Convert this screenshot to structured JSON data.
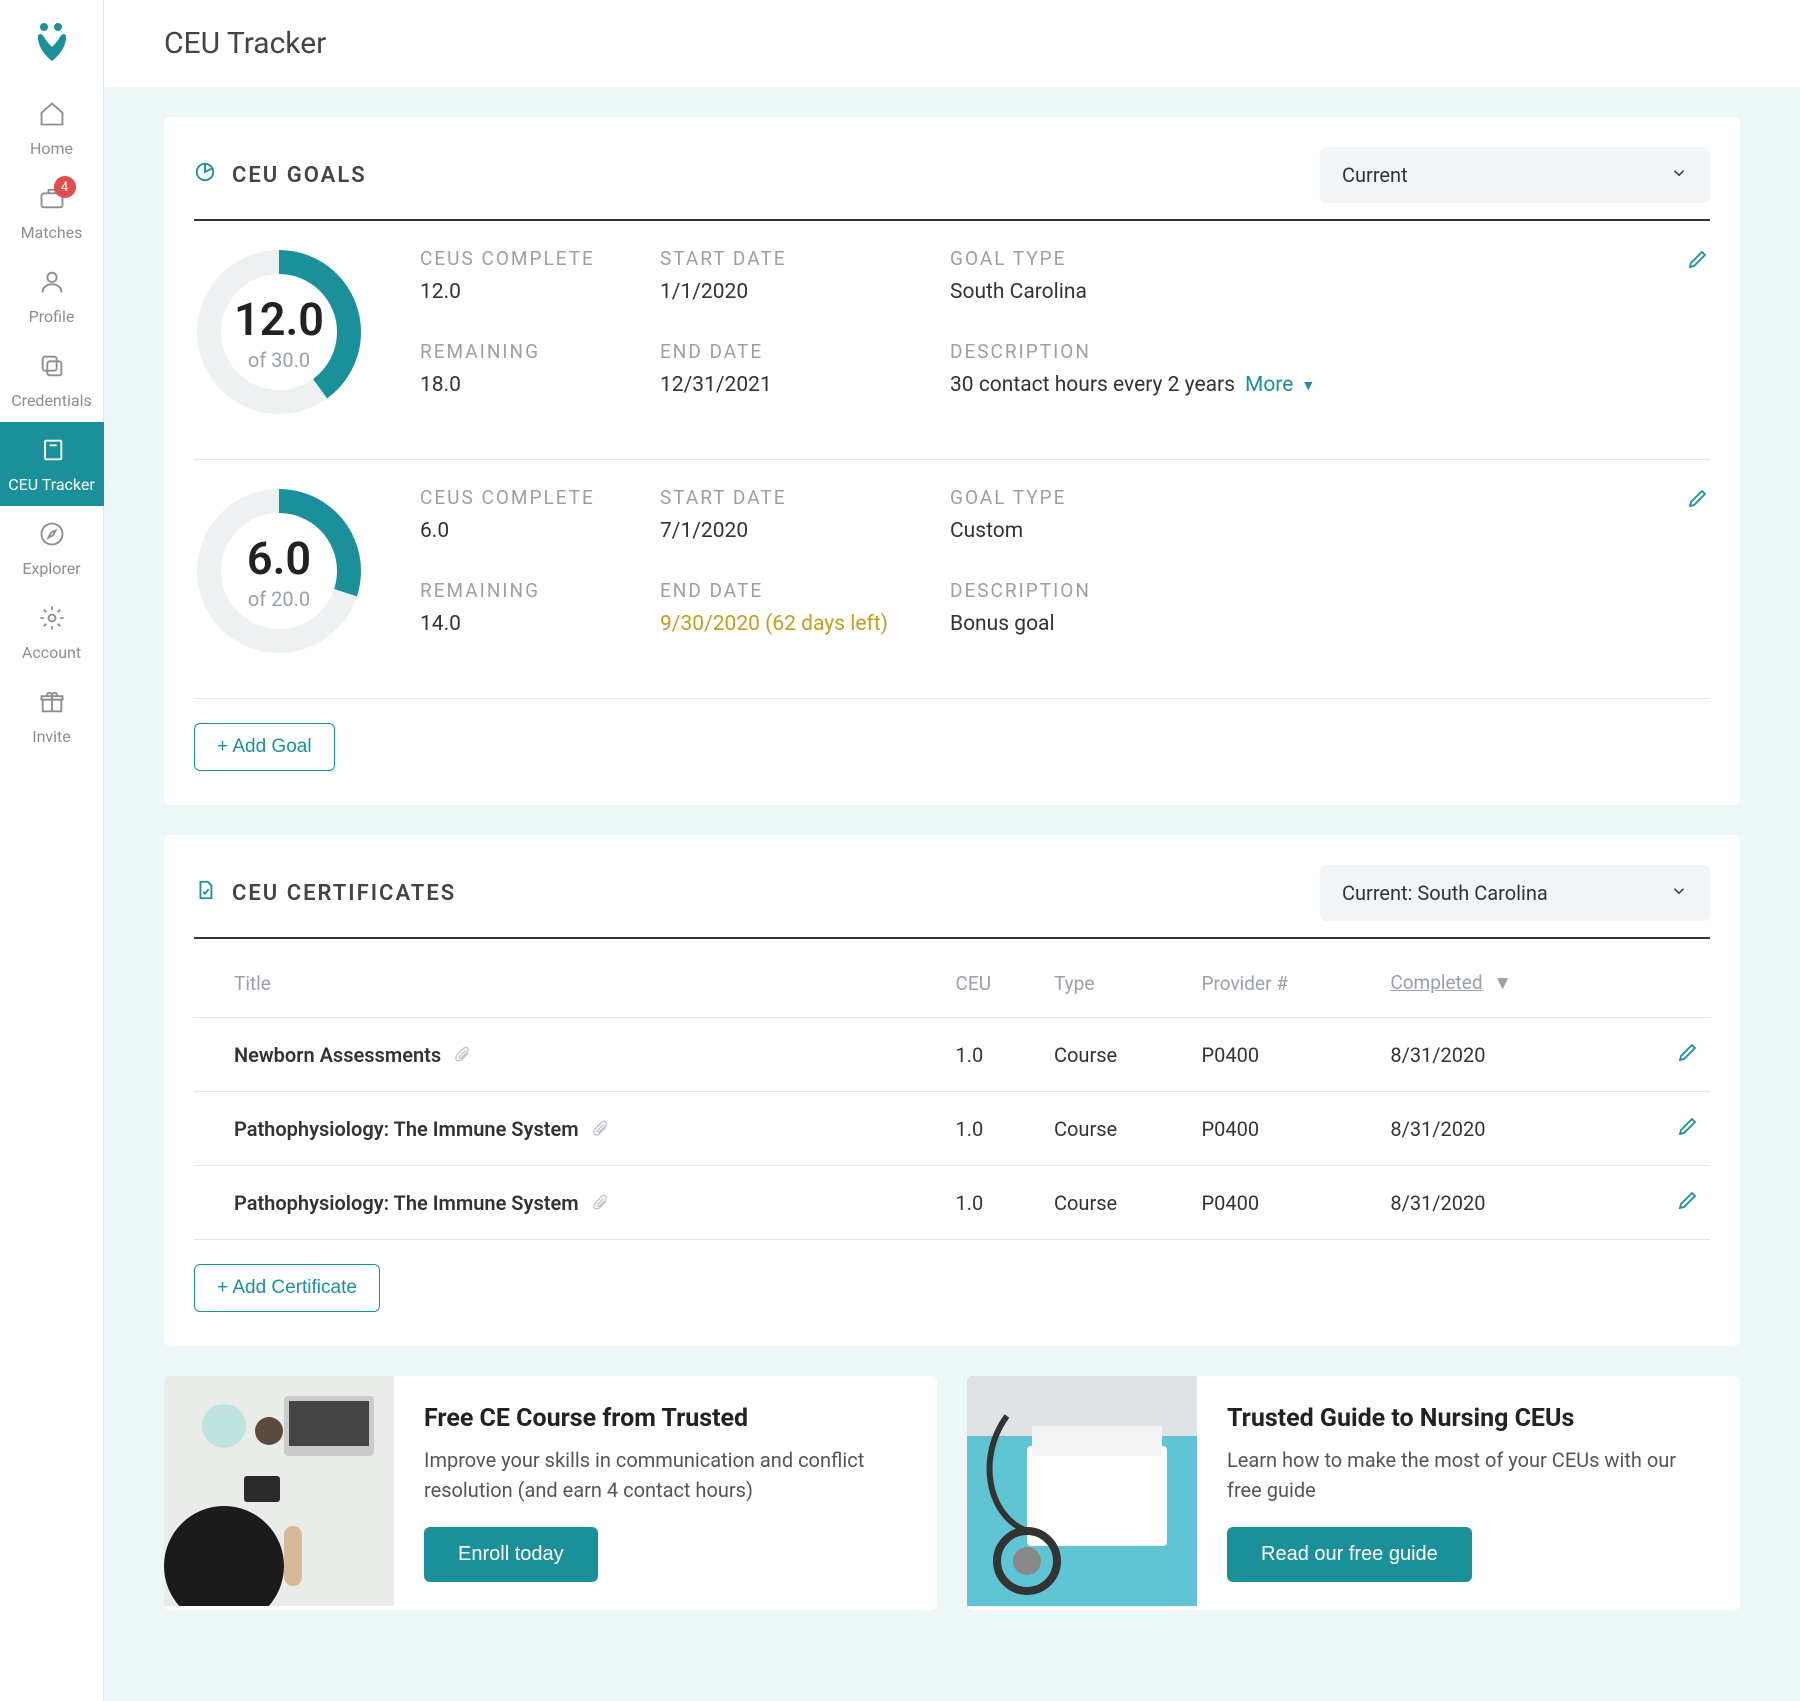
{
  "brand": {
    "accent": "#1a909a"
  },
  "header": {
    "title": "CEU Tracker"
  },
  "sidebar": {
    "items": [
      {
        "label": "Home"
      },
      {
        "label": "Matches",
        "badge": "4"
      },
      {
        "label": "Profile"
      },
      {
        "label": "Credentials"
      },
      {
        "label": "CEU Tracker"
      },
      {
        "label": "Explorer"
      },
      {
        "label": "Account"
      },
      {
        "label": "Invite"
      }
    ]
  },
  "goals_card": {
    "title": "CEU GOALS",
    "filter_selected": "Current",
    "add_button": "+ Add Goal",
    "labels": {
      "ceus_complete": "CEUS COMPLETE",
      "remaining": "REMAINING",
      "start_date": "START DATE",
      "end_date": "END DATE",
      "goal_type": "GOAL TYPE",
      "description": "DESCRIPTION",
      "more": "More"
    },
    "goals": [
      {
        "done": "12.0",
        "of": "of 30.0",
        "remaining": "18.0",
        "start": "1/1/2020",
        "end": "12/31/2021",
        "end_warn": false,
        "type": "South Carolina",
        "desc": "30 contact hours every 2 years",
        "show_more": true,
        "frac": 0.4
      },
      {
        "done": "6.0",
        "of": "of 20.0",
        "remaining": "14.0",
        "start": "7/1/2020",
        "end": "9/30/2020 (62 days left)",
        "end_warn": true,
        "type": "Custom",
        "desc": "Bonus goal",
        "show_more": false,
        "frac": 0.3
      }
    ]
  },
  "certs_card": {
    "title": "CEU CERTIFICATES",
    "filter_selected": "Current: South Carolina",
    "add_button": "+ Add Certificate",
    "columns": {
      "title": "Title",
      "ceu": "CEU",
      "type": "Type",
      "provider": "Provider #",
      "completed": "Completed"
    },
    "rows": [
      {
        "title": "Newborn Assessments",
        "ceu": "1.0",
        "type": "Course",
        "provider": "P0400",
        "completed": "8/31/2020"
      },
      {
        "title": "Pathophysiology: The Immune System",
        "ceu": "1.0",
        "type": "Course",
        "provider": "P0400",
        "completed": "8/31/2020"
      },
      {
        "title": "Pathophysiology: The Immune System",
        "ceu": "1.0",
        "type": "Course",
        "provider": "P0400",
        "completed": "8/31/2020"
      }
    ]
  },
  "promos": [
    {
      "title": "Free CE Course from Trusted",
      "desc": "Improve your skills in communication and conflict resolution (and earn 4 contact hours)",
      "cta": "Enroll today"
    },
    {
      "title": "Trusted Guide to Nursing CEUs",
      "desc": "Learn how to make the most of your CEUs with our free guide",
      "cta": "Read our free guide"
    }
  ]
}
